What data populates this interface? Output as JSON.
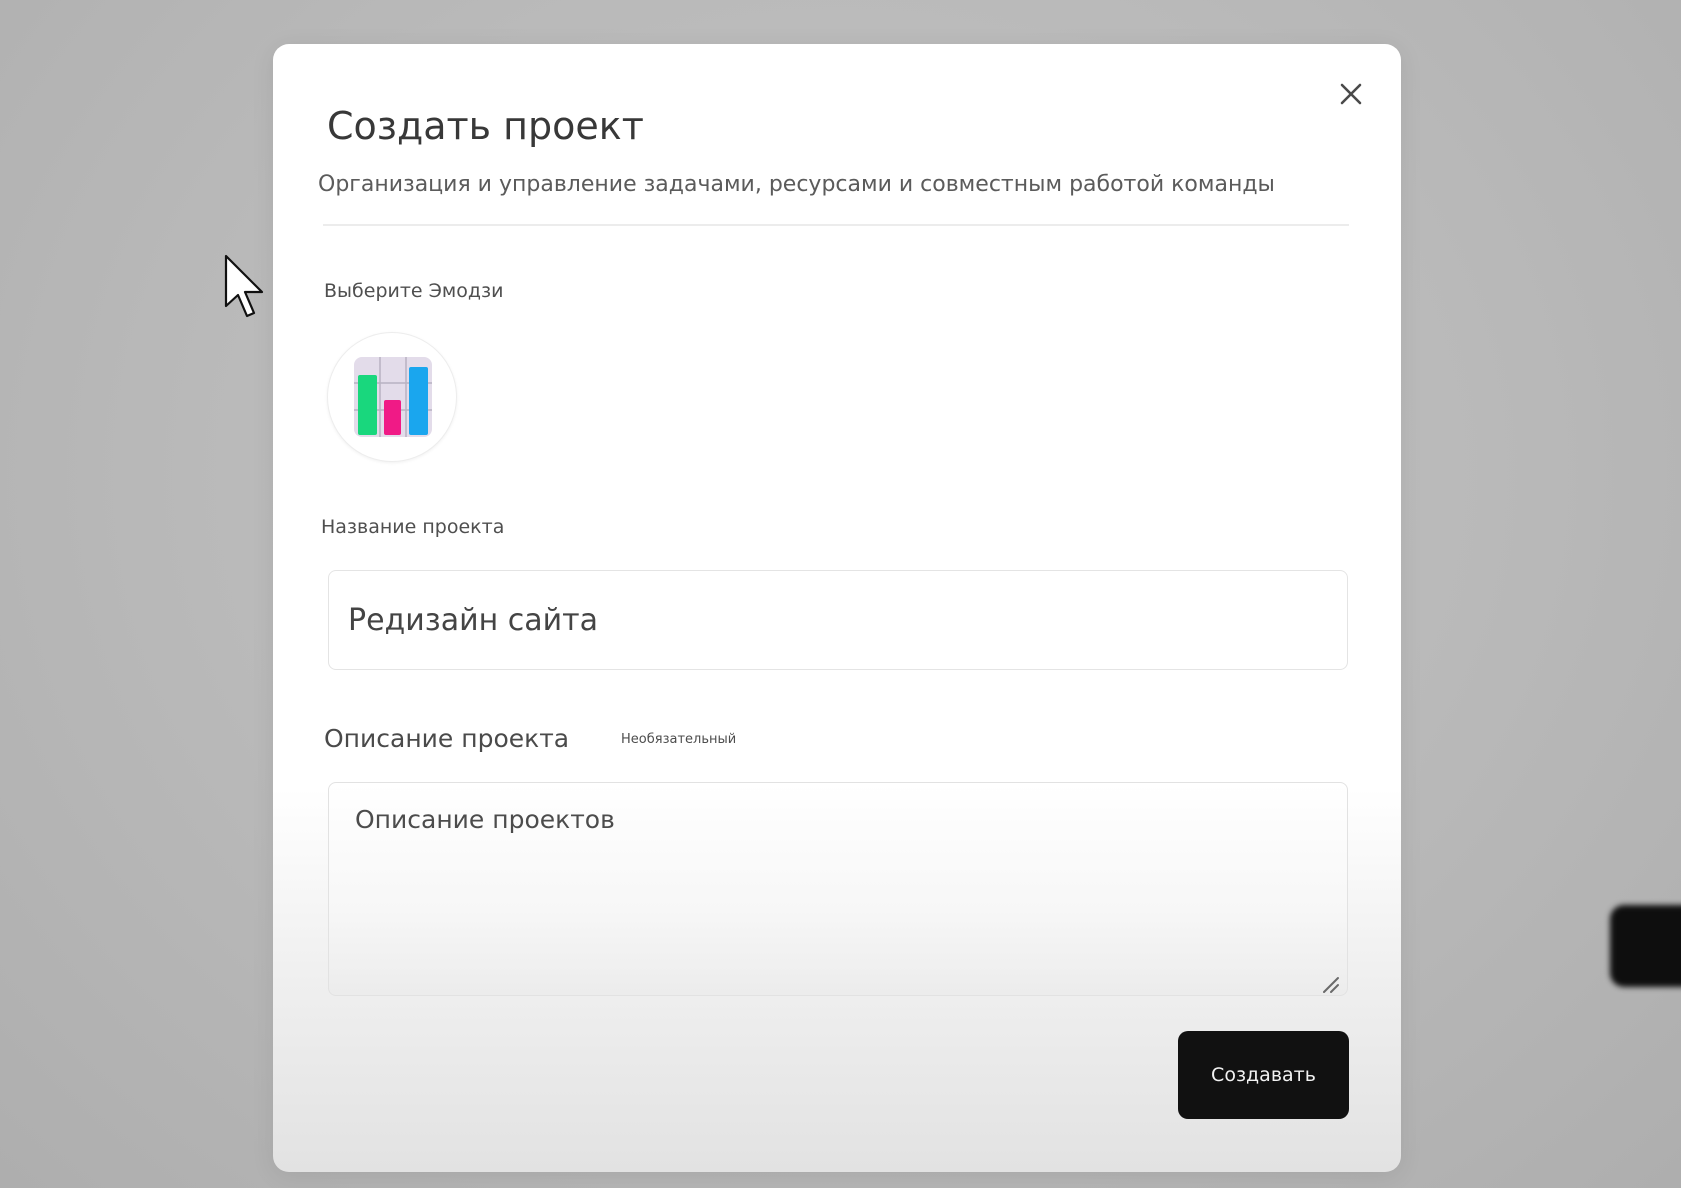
{
  "modal": {
    "title": "Создать проект",
    "subtitle": "Организация и управление задачами, ресурсами и совместным работой команды",
    "close_icon": "close-icon"
  },
  "emoji": {
    "label": "Выберите Эмодзи",
    "selected_icon": "bar-chart-emoji-icon"
  },
  "project_name": {
    "label": "Название проекта",
    "value": "Редизайн сайта"
  },
  "project_description": {
    "label": "Описание проекта",
    "optional_tag": "Необязательный",
    "placeholder": "Описание проектов"
  },
  "actions": {
    "create_label": "Создавать"
  },
  "colors": {
    "primary_button": "#111111",
    "modal_background": "#ffffff",
    "backdrop": "#b9b9b9"
  }
}
